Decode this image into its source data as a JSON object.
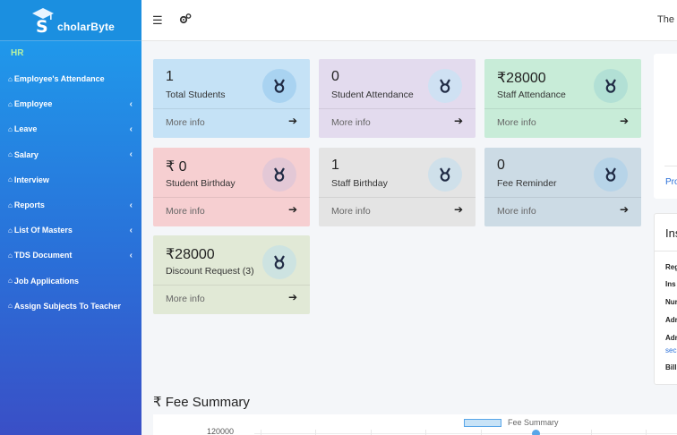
{
  "brand": {
    "name": "cholarByte",
    "initial": "S"
  },
  "sidebar": {
    "section": "HR",
    "items": [
      {
        "label": "Employee's Attendance",
        "has_submenu": false
      },
      {
        "label": "Employee",
        "has_submenu": true
      },
      {
        "label": "Leave",
        "has_submenu": true
      },
      {
        "label": "Salary",
        "has_submenu": true
      },
      {
        "label": "Interview",
        "has_submenu": false
      },
      {
        "label": "Reports",
        "has_submenu": true
      },
      {
        "label": "List Of Masters",
        "has_submenu": true
      },
      {
        "label": "TDS Document",
        "has_submenu": true
      },
      {
        "label": "Job Applications",
        "has_submenu": false
      },
      {
        "label": "Assign Subjects To Teacher",
        "has_submenu": false
      }
    ]
  },
  "topbar": {
    "text": "The"
  },
  "cards": [
    {
      "value": "1",
      "label": "Total Students",
      "more": "More info"
    },
    {
      "value": "0",
      "label": "Student Attendance",
      "more": "More info"
    },
    {
      "value": "₹28000",
      "label": "Staff Attendance",
      "more": "More info"
    },
    {
      "value": "₹ 0",
      "label": "Student Birthday",
      "more": "More info"
    },
    {
      "value": "1",
      "label": "Staff Birthday",
      "more": "More info"
    },
    {
      "value": "0",
      "label": "Fee Reminder",
      "more": "More info"
    },
    {
      "value": "₹28000",
      "label": "Discount Request (3)",
      "more": "More info"
    }
  ],
  "right_panel": {
    "link": "Pro",
    "title": "Ins",
    "rows": [
      "Reg",
      "Ins",
      "Nur",
      "Adr",
      "Adr",
      "Bill"
    ],
    "link2": "sec"
  },
  "fee_summary": {
    "title": "₹ Fee Summary",
    "legend": "Fee Summary",
    "y_tick": "120000"
  },
  "colors": {
    "sidebar_top": "#1ea0ee",
    "sidebar_bottom": "#3a4fc6",
    "accent": "#2a6fd8"
  }
}
